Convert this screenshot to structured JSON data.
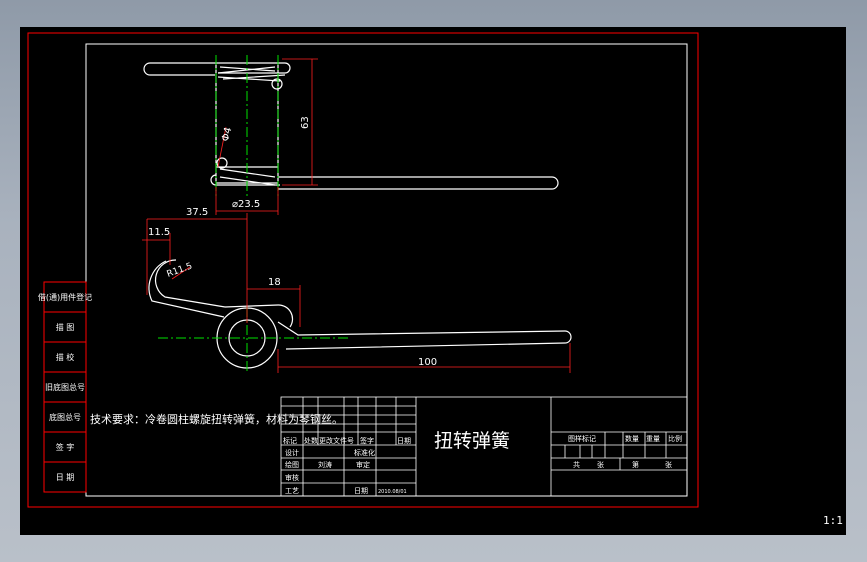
{
  "part": {
    "dim_phi4": "Φ4",
    "dim_63": "63",
    "dim_phi23_5": "⌀23.5",
    "dim_37_5": "37.5",
    "dim_11_5": "11.5",
    "dim_r11_5": "R11.5",
    "dim_18": "18",
    "dim_100": "100"
  },
  "notes": {
    "tech_req": "技术要求：冷卷圆柱螺旋扭转弹簧，材料为琴钢丝。"
  },
  "side_table": {
    "rows": [
      "借(通)用件登记",
      "描 图",
      "描 校",
      "旧底图总号",
      "底图总号",
      "签 字",
      "日 期"
    ]
  },
  "title_block": {
    "title": "扭转弹簧",
    "header": [
      "标记",
      "处数",
      "更改文件号",
      "签字",
      "日期"
    ],
    "roles": [
      "设计",
      "绘图",
      "审核",
      "工艺"
    ],
    "labels": {
      "standardize": "标准化",
      "approve": "审定",
      "date": "日期",
      "date_value": "2010.08/01",
      "drawer": "刘涛"
    },
    "right": {
      "stage_mark": "图样标记",
      "quantity": "数量",
      "weight": "重量",
      "scale": "比例",
      "total": "共",
      "sheet": "第",
      "zhang1": "张",
      "zhang2": "张"
    }
  },
  "viewport": {
    "scale_label": "1:1"
  },
  "colors": {
    "frame": "#ff0000",
    "line": "#ffffff",
    "dim": "#ff2020",
    "center": "#00e000",
    "background": "#000000"
  }
}
